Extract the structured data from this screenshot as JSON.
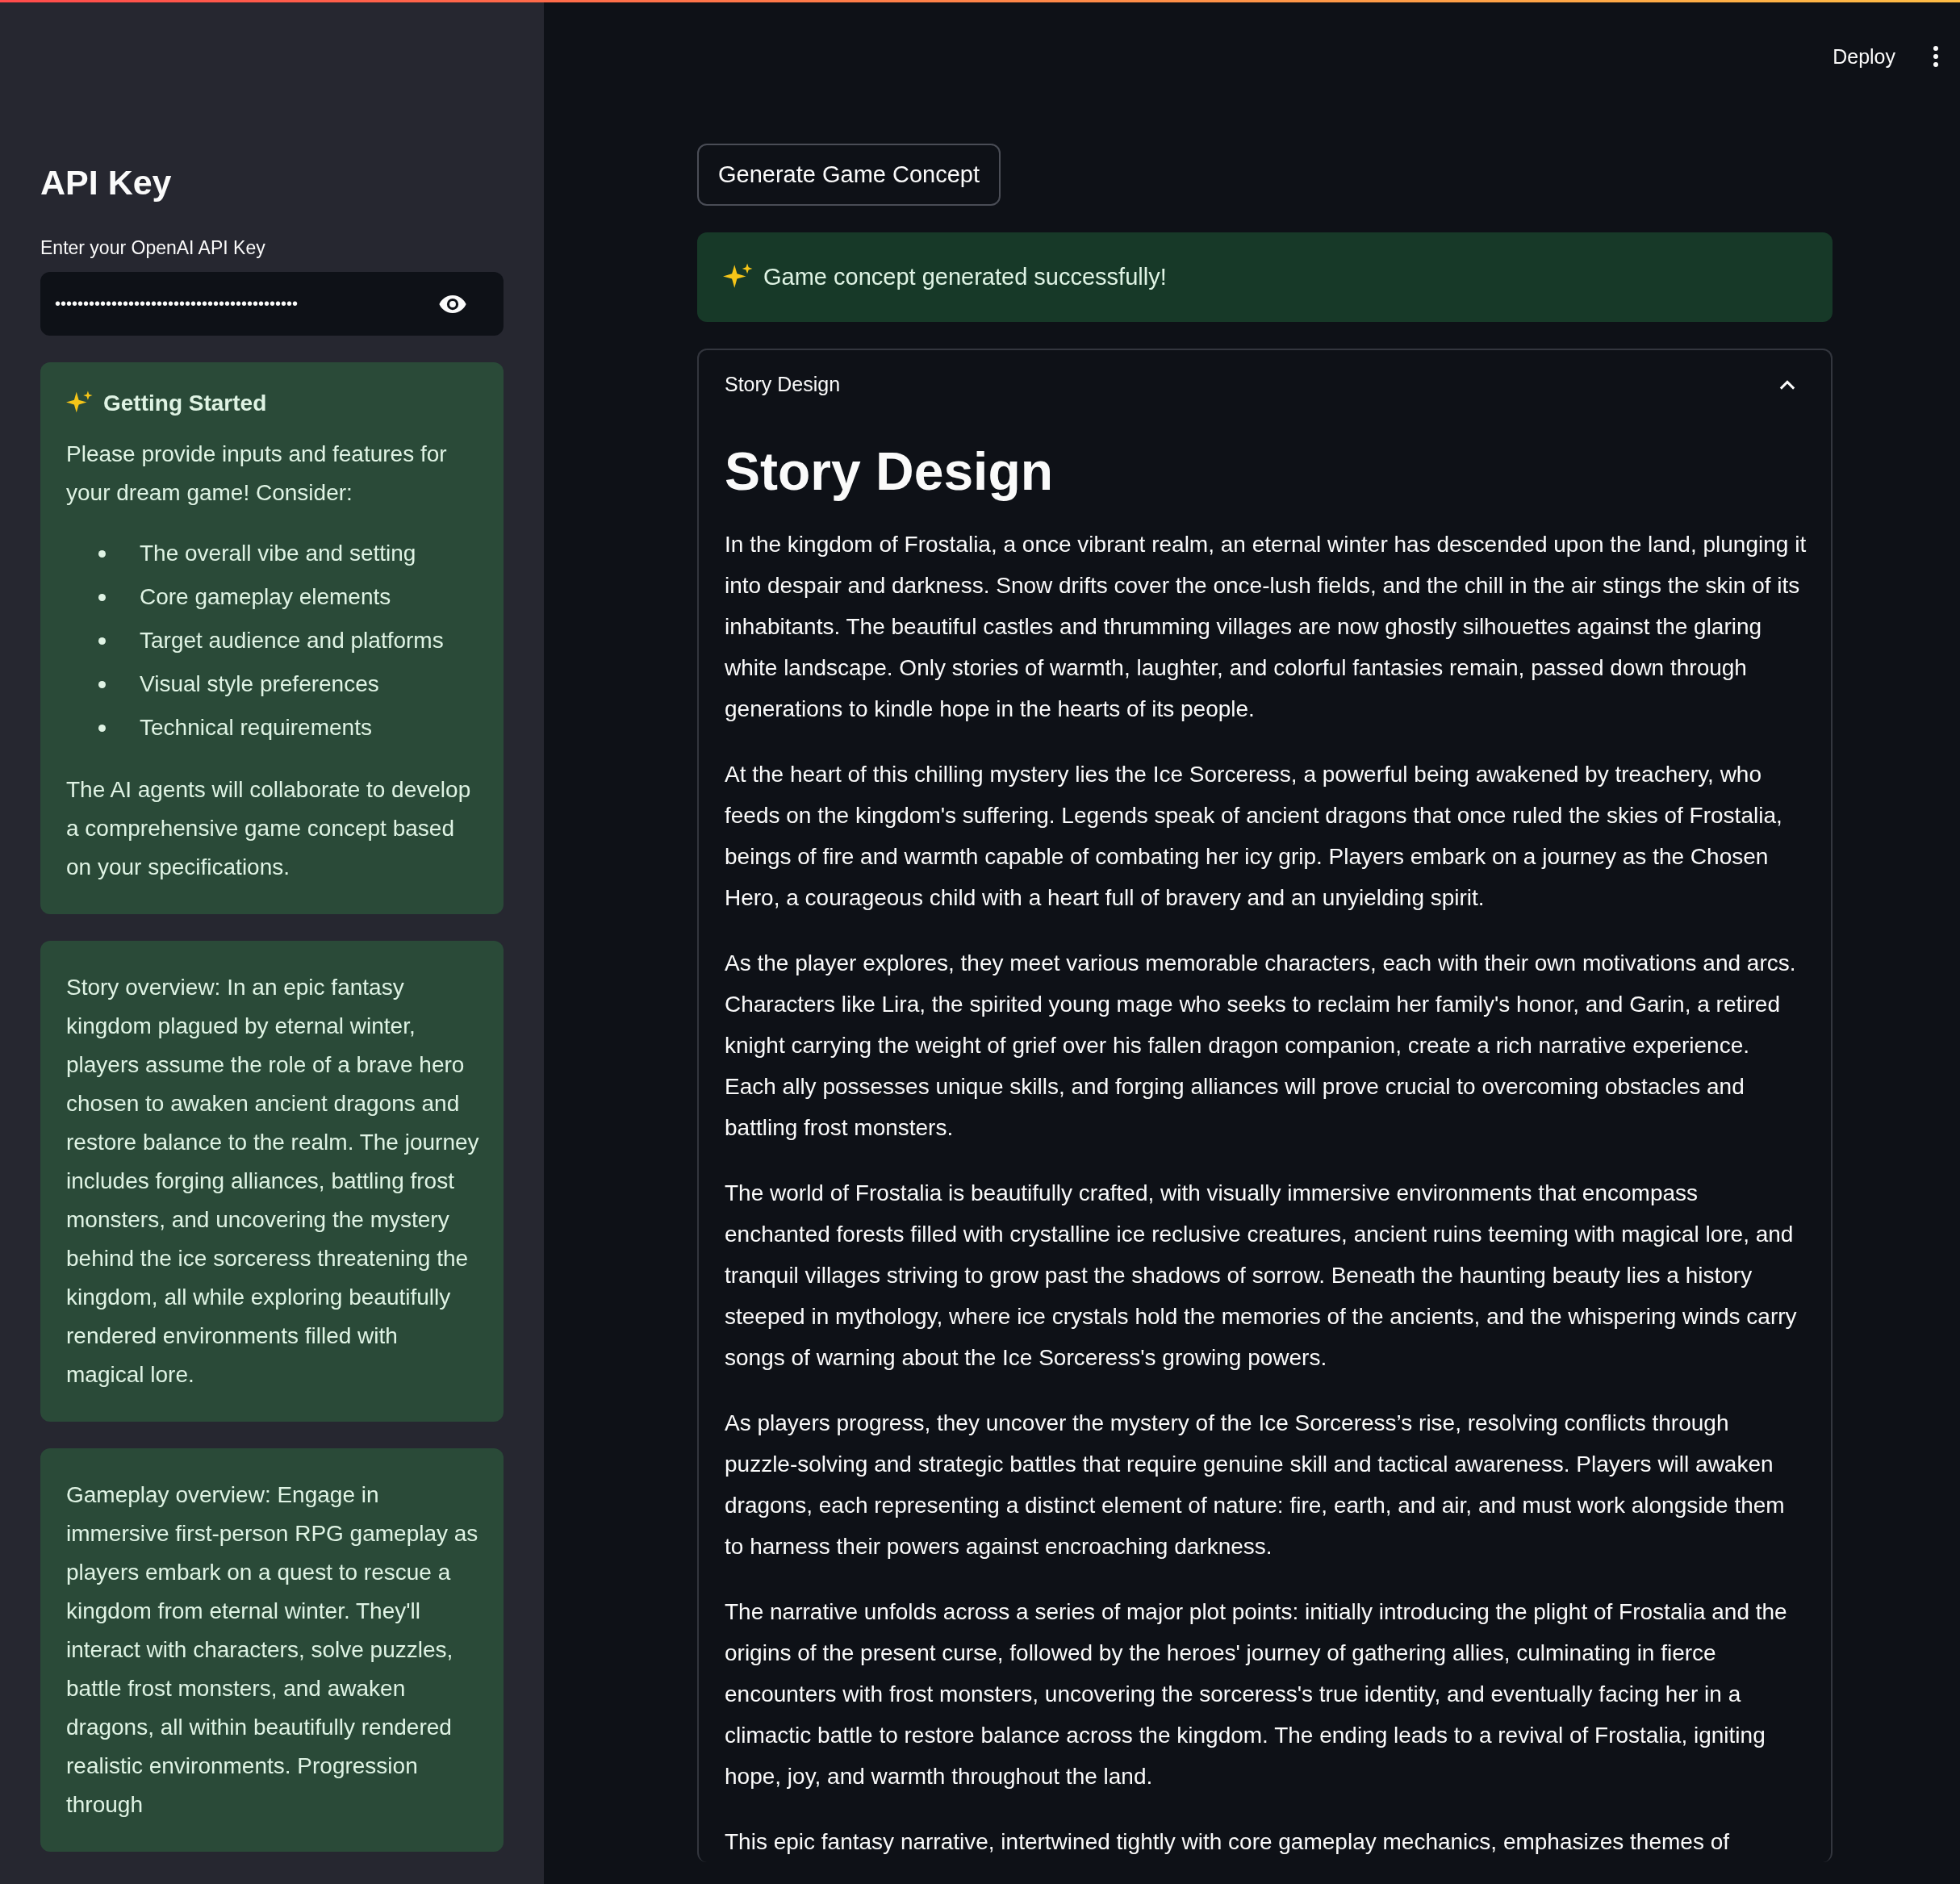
{
  "header": {
    "deploy": "Deploy"
  },
  "sidebar": {
    "title": "API Key",
    "field_label": "Enter your OpenAI API Key",
    "api_key": "•••••••••••••••••••••••••••••••••••••••••••",
    "cards": [
      {
        "kind": "info",
        "title": "Getting Started",
        "intro": "Please provide inputs and features for your dream game! Consider:",
        "bullets": [
          "The overall vibe and setting",
          "Core gameplay elements",
          "Target audience and platforms",
          "Visual style preferences",
          "Technical requirements"
        ],
        "outro": "The AI agents will collaborate to develop a comprehensive game concept based on your specifications."
      },
      {
        "kind": "text",
        "text": "Story overview: In an epic fantasy kingdom plagued by eternal winter, players assume the role of a brave hero chosen to awaken ancient dragons and restore balance to the realm. The journey includes forging alliances, battling frost monsters, and uncovering the mystery behind the ice sorceress threatening the kingdom, all while exploring beautifully rendered environments filled with magical lore."
      },
      {
        "kind": "text",
        "text": "Gameplay overview: Engage in immersive first-person RPG gameplay as players embark on a quest to rescue a kingdom from eternal winter. They'll interact with characters, solve puzzles, battle frost monsters, and awaken dragons, all within beautifully rendered realistic environments. Progression through"
      }
    ]
  },
  "main": {
    "button": "Generate Game Concept",
    "success": "Game concept generated successfully!",
    "expander": {
      "label": "Story Design",
      "expanded": true,
      "heading": "Story Design",
      "paragraphs": [
        "In the kingdom of Frostalia, a once vibrant realm, an eternal winter has descended upon the land, plunging it into despair and darkness. Snow drifts cover the once-lush fields, and the chill in the air stings the skin of its inhabitants. The beautiful castles and thrumming villages are now ghostly silhouettes against the glaring white landscape. Only stories of warmth, laughter, and colorful fantasies remain, passed down through generations to kindle hope in the hearts of its people.",
        "At the heart of this chilling mystery lies the Ice Sorceress, a powerful being awakened by treachery, who feeds on the kingdom's suffering. Legends speak of ancient dragons that once ruled the skies of Frostalia, beings of fire and warmth capable of combating her icy grip. Players embark on a journey as the Chosen Hero, a courageous child with a heart full of bravery and an unyielding spirit.",
        "As the player explores, they meet various memorable characters, each with their own motivations and arcs. Characters like Lira, the spirited young mage who seeks to reclaim her family's honor, and Garin, a retired knight carrying the weight of grief over his fallen dragon companion, create a rich narrative experience. Each ally possesses unique skills, and forging alliances will prove crucial to overcoming obstacles and battling frost monsters.",
        "The world of Frostalia is beautifully crafted, with visually immersive environments that encompass enchanted forests filled with crystalline ice reclusive creatures, ancient ruins teeming with magical lore, and tranquil villages striving to grow past the shadows of sorrow. Beneath the haunting beauty lies a history steeped in mythology, where ice crystals hold the memories of the ancients, and the whispering winds carry songs of warning about the Ice Sorceress's growing powers.",
        "As players progress, they uncover the mystery of the Ice Sorceress’s rise, resolving conflicts through puzzle-solving and strategic battles that require genuine skill and tactical awareness. Players will awaken dragons, each representing a distinct element of nature: fire, earth, and air, and must work alongside them to harness their powers against encroaching darkness.",
        "The narrative unfolds across a series of major plot points: initially introducing the plight of Frostalia and the origins of the present curse, followed by the heroes' journey of gathering allies, culminating in fierce encounters with frost monsters, uncovering the sorceress's true identity, and eventually facing her in a climactic battle to restore balance across the kingdom. The ending leads to a revival of Frostalia, igniting hope, joy, and warmth throughout the land.",
        "This epic fantasy narrative, intertwined tightly with core gameplay mechanics, emphasizes themes of"
      ]
    }
  }
}
